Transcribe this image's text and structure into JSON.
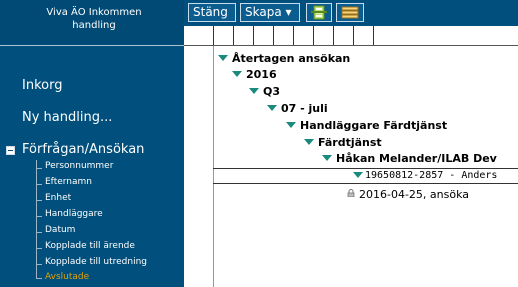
{
  "app": {
    "title_line1": "Viva ÄO Inkommen",
    "title_line2": "handling"
  },
  "toolbar": {
    "close_label": "Stäng",
    "create_label": "Skapa",
    "create_arrow": "▾"
  },
  "nav": {
    "inbox": "Inkorg",
    "new_case": "Ny handling...",
    "query": "Förfrågan/Ansökan",
    "sub_items": [
      "Personnummer",
      "Efternamn",
      "Enhet",
      "Handläggare",
      "Datum",
      "Kopplade till ärende",
      "Kopplade till utredning",
      "Avslutade"
    ]
  },
  "tree": {
    "level0": "Återtagen ansökan",
    "level1": "2016",
    "level2": "Q3",
    "level3": "07 - juli",
    "level4": "Handläggare Färdtjänst",
    "level5": "Färdtjänst",
    "level6": "Håkan Melander/ILAB Dev",
    "person": "19650812-2857 - Anders",
    "case": "2016-04-25, ansöka"
  },
  "colors": {
    "sidebar_bg": "#004f7c",
    "active_item": "#e2a000",
    "tree_triangle": "#1a8a7e"
  }
}
